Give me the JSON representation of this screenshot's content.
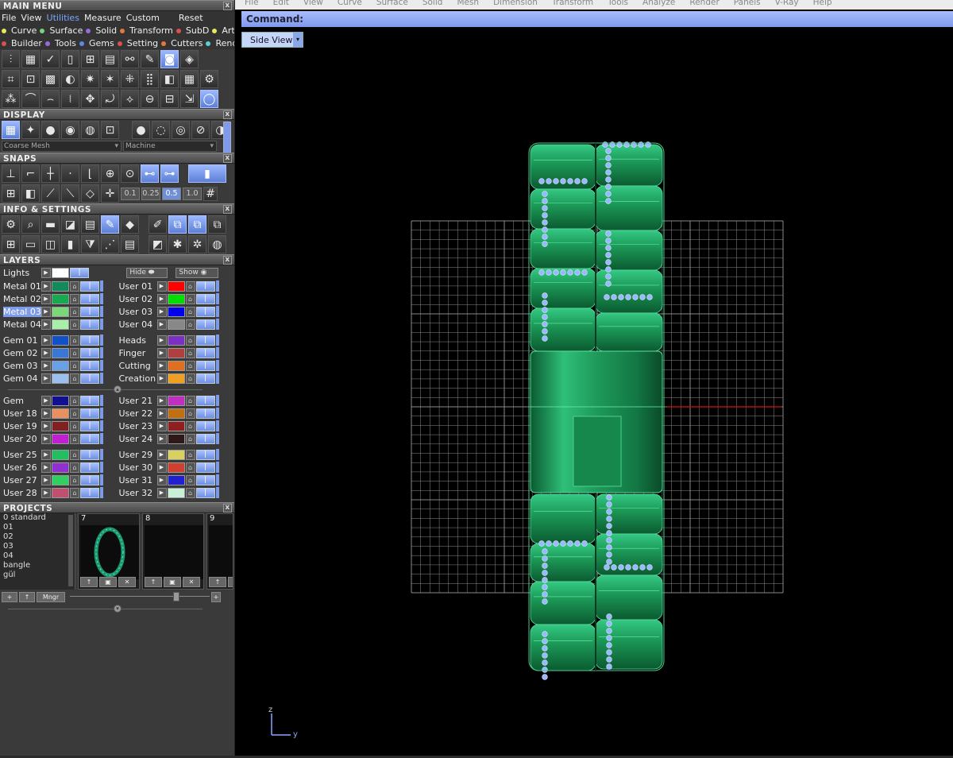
{
  "main_menu": {
    "title": "MAIN MENU",
    "top_items": [
      "File",
      "View",
      "Utilities",
      "Measure",
      "Custom"
    ],
    "reset_label": "Reset",
    "row1": [
      {
        "label": "Curve",
        "color": "#e8e85a"
      },
      {
        "label": "Surface",
        "color": "#7bd27b"
      },
      {
        "label": "Solid",
        "color": "#9a6ad8"
      },
      {
        "label": "Transform",
        "color": "#e07a3a"
      },
      {
        "label": "SubD",
        "color": "#d85050"
      },
      {
        "label": "Art",
        "color": "#e8e85a"
      }
    ],
    "row2": [
      {
        "label": "Builder",
        "color": "#d85050"
      },
      {
        "label": "Tools",
        "color": "#9a6ad8"
      },
      {
        "label": "Gems",
        "color": "#5a8ae0"
      },
      {
        "label": "Setting",
        "color": "#d85050"
      },
      {
        "label": "Cutters",
        "color": "#e07a3a"
      },
      {
        "label": "Render",
        "color": "#5ad0d0"
      }
    ]
  },
  "display": {
    "title": "DISPLAY",
    "mesh_select": "Coarse Mesh",
    "material_select": "Machine"
  },
  "snaps": {
    "title": "SNAPS",
    "increments": [
      "0.1",
      "0.25",
      "0.5",
      "1.0"
    ],
    "selected_increment": "0.5"
  },
  "info": {
    "title": "INFO & SETTINGS"
  },
  "layers": {
    "title": "LAYERS",
    "lights_label": "Lights",
    "hide_label": "Hide",
    "show_label": "Show",
    "groups": [
      [
        {
          "left": {
            "name": "Metal 01",
            "color": "#138a5a"
          },
          "right": {
            "name": "User 01",
            "color": "#ff0000"
          }
        },
        {
          "left": {
            "name": "Metal 02",
            "color": "#18a850"
          },
          "right": {
            "name": "User 02",
            "color": "#00dd00"
          }
        },
        {
          "left": {
            "name": "Metal 03",
            "color": "#7ad87a",
            "selected": true
          },
          "right": {
            "name": "User 03",
            "color": "#0000ee"
          }
        },
        {
          "left": {
            "name": "Metal 04",
            "color": "#a8f0a8"
          },
          "right": {
            "name": "User 04",
            "color": "#888888"
          }
        }
      ],
      [
        {
          "left": {
            "name": "Gem 01",
            "color": "#1050c8"
          },
          "right": {
            "name": "Heads",
            "color": "#7a30c0"
          }
        },
        {
          "left": {
            "name": "Gem 02",
            "color": "#3a78d8"
          },
          "right": {
            "name": "Finger",
            "color": "#b04040"
          }
        },
        {
          "left": {
            "name": "Gem 03",
            "color": "#6aa0e8"
          },
          "right": {
            "name": "Cutting",
            "color": "#e07020"
          }
        },
        {
          "left": {
            "name": "Gem 04",
            "color": "#9ac0f0"
          },
          "right": {
            "name": "Creation",
            "color": "#f0a020"
          }
        }
      ],
      [
        {
          "left": {
            "name": "Gem",
            "color": "#101090"
          },
          "right": {
            "name": "User 21",
            "color": "#c030c0"
          }
        },
        {
          "left": {
            "name": "User 18",
            "color": "#e89060"
          },
          "right": {
            "name": "User 22",
            "color": "#c07010"
          }
        },
        {
          "left": {
            "name": "User 19",
            "color": "#802020"
          },
          "right": {
            "name": "User 23",
            "color": "#902020"
          }
        },
        {
          "left": {
            "name": "User 20",
            "color": "#c020d0"
          },
          "right": {
            "name": "User 24",
            "color": "#301818"
          }
        }
      ],
      [
        {
          "left": {
            "name": "User 25",
            "color": "#20c060"
          },
          "right": {
            "name": "User 29",
            "color": "#d8d060"
          }
        },
        {
          "left": {
            "name": "User 26",
            "color": "#9030d0"
          },
          "right": {
            "name": "User 30",
            "color": "#d04030"
          }
        },
        {
          "left": {
            "name": "User 27",
            "color": "#30d060"
          },
          "right": {
            "name": "User 31",
            "color": "#2020d0"
          }
        },
        {
          "left": {
            "name": "User 28",
            "color": "#c05070"
          },
          "right": {
            "name": "User 32",
            "color": "#c8f0d8"
          }
        }
      ]
    ]
  },
  "projects": {
    "title": "PROJECTS",
    "list": [
      "0 standard",
      "01",
      "02",
      "03",
      "04",
      "bangle",
      "gül"
    ],
    "cards": [
      "7",
      "8",
      "9"
    ],
    "add_label": "+",
    "up_label": "↑",
    "manager_label": "Mngr"
  },
  "app_menu": [
    "File",
    "Edit",
    "View",
    "Curve",
    "Surface",
    "Solid",
    "Mesh",
    "Dimension",
    "Transform",
    "Tools",
    "Analyze",
    "Render",
    "Panels",
    "V-Ray",
    "Help"
  ],
  "command": {
    "label": "Command:"
  },
  "viewport": {
    "tab_label": "Side View",
    "axis_z": "z",
    "axis_y": "y"
  },
  "colors": {
    "accent": "#7f9aec",
    "model_green": "#1f9a5a",
    "grid": "#bdbdbd",
    "gems": "#9ab8ff"
  }
}
